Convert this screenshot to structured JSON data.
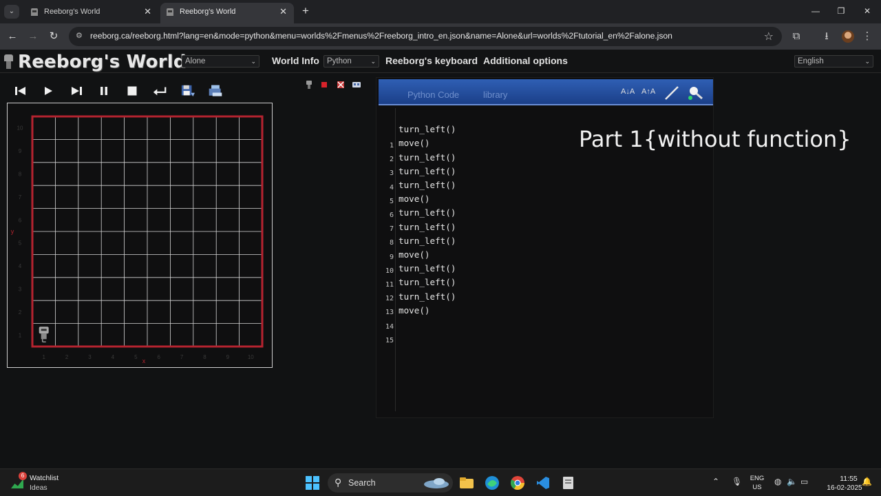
{
  "browser": {
    "tabs": [
      {
        "title": "Reeborg's World",
        "active": false
      },
      {
        "title": "Reeborg's World",
        "active": true
      }
    ],
    "url": "reeborg.ca/reeborg.html?lang=en&mode=python&menu=worlds%2Fmenus%2Freeborg_intro_en.json&name=Alone&url=worlds%2Ftutorial_en%2Falone.json",
    "icons": {
      "tab_search": "chevron-down-icon",
      "back": "arrow-left-icon",
      "forward": "arrow-right-icon",
      "reload": "reload-icon",
      "bookmark": "star-icon",
      "extensions": "puzzle-icon",
      "downloads": "download-icon",
      "menu": "more-vertical-icon"
    }
  },
  "app": {
    "title": "Reeborg's World",
    "world_select": "Alone",
    "language_mode": "Python",
    "menu": {
      "world_info": "World Info",
      "keyboard": "Reeborg's keyboard",
      "additional": "Additional options"
    },
    "ui_language": "English"
  },
  "controls": [
    "reverse-step",
    "run",
    "step",
    "pause",
    "stop",
    "reload",
    "save-world",
    "open-world"
  ],
  "editor": {
    "tabs": [
      "Python Code",
      "library"
    ],
    "lines": [
      "",
      "turn_left()",
      "move()",
      "turn_left()",
      "turn_left()",
      "turn_left()",
      "move()",
      "turn_left()",
      "turn_left()",
      "turn_left()",
      "move()",
      "turn_left()",
      "turn_left()",
      "turn_left()",
      "move()"
    ]
  },
  "world": {
    "cols": 10,
    "rows": 10,
    "robot": {
      "x": 1,
      "y": 1
    },
    "x_axis_label": "x",
    "y_axis_label": "y",
    "border_color": "#b5232f"
  },
  "overlay_text": "Part 1{without function}",
  "taskbar": {
    "widget_title": "Watchlist",
    "widget_sub": "Ideas",
    "widget_badge": "6",
    "search_label": "Search",
    "lang_top": "ENG",
    "lang_bottom": "US",
    "time": "11:55",
    "date": "16-02-2025"
  }
}
